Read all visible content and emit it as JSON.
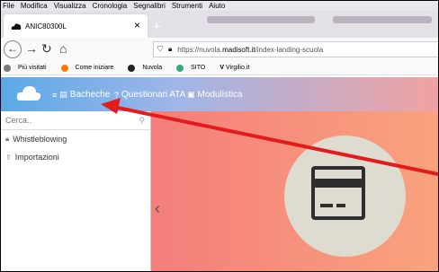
{
  "browser": {
    "menu": [
      "File",
      "Modifica",
      "Visualizza",
      "Cronologia",
      "Segnalibri",
      "Strumenti",
      "Aiuto"
    ],
    "tab_title": "ANIC80300L",
    "tab_close": "×",
    "new_tab": "+",
    "url": "https://nuvola.madisoft.it/index-landing-scuola",
    "bookmarks": [
      "Più visitati",
      "Come iniziare",
      "Nuvola",
      "SITO",
      "Virgilio.it"
    ]
  },
  "app": {
    "nav": [
      "Bacheche",
      "Questionari ATA",
      "Modulistica"
    ]
  },
  "sidebar": {
    "search_placeholder": "Cerca..",
    "items": [
      "Whistleblowing",
      "Importazioni"
    ]
  },
  "colors": {
    "header_start": "#5aa9e6",
    "header_end": "#f1a2a2",
    "main_start": "#f47e7b",
    "arrow": "#e31b1b"
  },
  "icons": [
    "menu-icon",
    "list-icon",
    "question-icon",
    "folder-icon",
    "card-icon",
    "chevron-left-icon",
    "search-icon",
    "lock-icon",
    "upload-icon"
  ]
}
